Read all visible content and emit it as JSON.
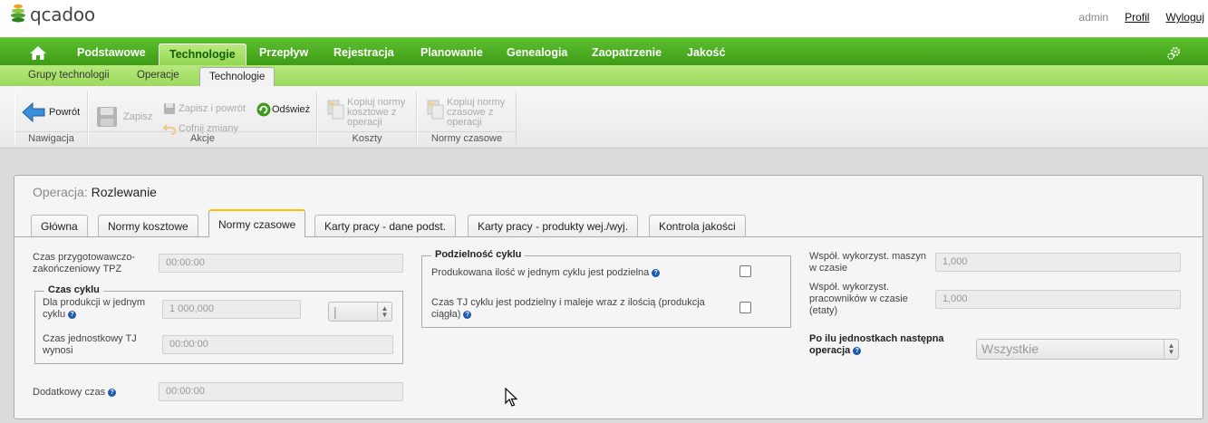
{
  "header": {
    "logo_text": "qcadoo",
    "user": "admin",
    "profile_link": "Profil",
    "logout_link": "Wyloguj"
  },
  "main_menu": [
    "Podstawowe",
    "Technologie",
    "Przepływ",
    "Rejestracja",
    "Planowanie",
    "Genealogia",
    "Zaopatrzenie",
    "Jakość"
  ],
  "main_menu_active": "Technologie",
  "sub_menu": [
    "Grupy technologii",
    "Operacje",
    "Technologie"
  ],
  "sub_menu_active": "Technologie",
  "ribbon": {
    "back": "Powrót",
    "save": "Zapisz",
    "save_back": "Zapisz i powrót",
    "cancel_changes": "Cofnij zmiany",
    "refresh": "Odśwież",
    "copy_cost_norms": "Kopiuj normy kosztowe z operacji",
    "copy_time_norms": "Kopiuj normy czasowe z operacji",
    "groups": [
      "Nawigacja",
      "Akcje",
      "Koszty",
      "Normy czasowe"
    ]
  },
  "form": {
    "title_key": "Operacja:",
    "title_value": "Rozlewanie",
    "tabs": [
      "Główna",
      "Normy kosztowe",
      "Normy czasowe",
      "Karty pracy - dane podst.",
      "Karty pracy - produkty wej./wyj.",
      "Kontrola jakości"
    ],
    "active_tab": "Normy czasowe",
    "tpz_label": "Czas przygotowawczo-zakończeniowy TPZ",
    "tpz_value": "00:00:00",
    "cycle_legend": "Czas cyklu",
    "production_label": "Dla produkcji w jednym cyklu",
    "production_value": "1 000,000",
    "unit_select_value": "|",
    "tj_label": "Czas jednostkowy TJ wynosi",
    "tj_value": "00:00:00",
    "additional_time_label": "Dodatkowy czas",
    "additional_time_value": "00:00:00",
    "divisibility_legend": "Podzielność cyklu",
    "divisible_label": "Produkowana ilość w jednym cyklu jest podzielna",
    "divisible_checked": false,
    "tj_divisible_label": "Czas TJ cyklu jest podzielny i maleje wraz z ilością (produkcja ciągła)",
    "tj_divisible_checked": false,
    "machine_util_label": "Współ. wykorzyst. maszyn w czasie",
    "machine_util_value": "1,000",
    "worker_util_label": "Współ. wykorzyst. pracowników w czasie (etaty)",
    "worker_util_value": "1,000",
    "next_op_label": "Po ilu jednostkach następna operacja",
    "next_op_value": "Wszystkie"
  },
  "colors": {
    "menu_green": "#4caf23",
    "submenu_green": "#a8df6a",
    "active_tab_accent": "#ffbf00",
    "help_blue": "#1c5bb1"
  }
}
